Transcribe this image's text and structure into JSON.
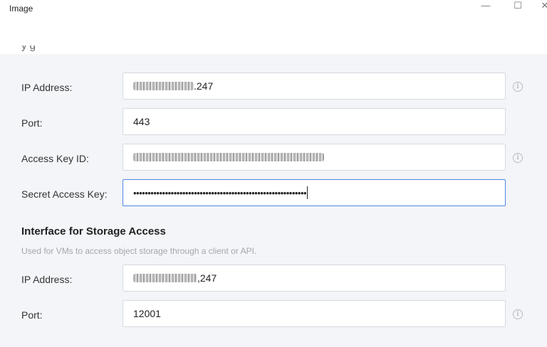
{
  "window": {
    "title": "Image",
    "minimize_glyph": "—",
    "maximize_glyph": "☐",
    "close_glyph": "✕",
    "partial_heading": "y     g"
  },
  "management": {
    "ip_label": "IP Address:",
    "ip_value_visible_suffix": ".247",
    "port_label": "Port:",
    "port_value": "443",
    "access_key_label": "Access Key ID:",
    "secret_key_label": "Secret Access Key:",
    "secret_key_value": "••••••••••••••••••••••••••••••••••••••••••••••••••••••••••••"
  },
  "storage_access": {
    "title": "Interface for Storage Access",
    "description": "Used for VMs to access object storage through a client or API.",
    "ip_label": "IP Address:",
    "ip_value_visible_suffix": ",247",
    "port_label": "Port:",
    "port_value": "12001"
  },
  "icons": {
    "info": "info-icon",
    "info_glyph": "i"
  }
}
